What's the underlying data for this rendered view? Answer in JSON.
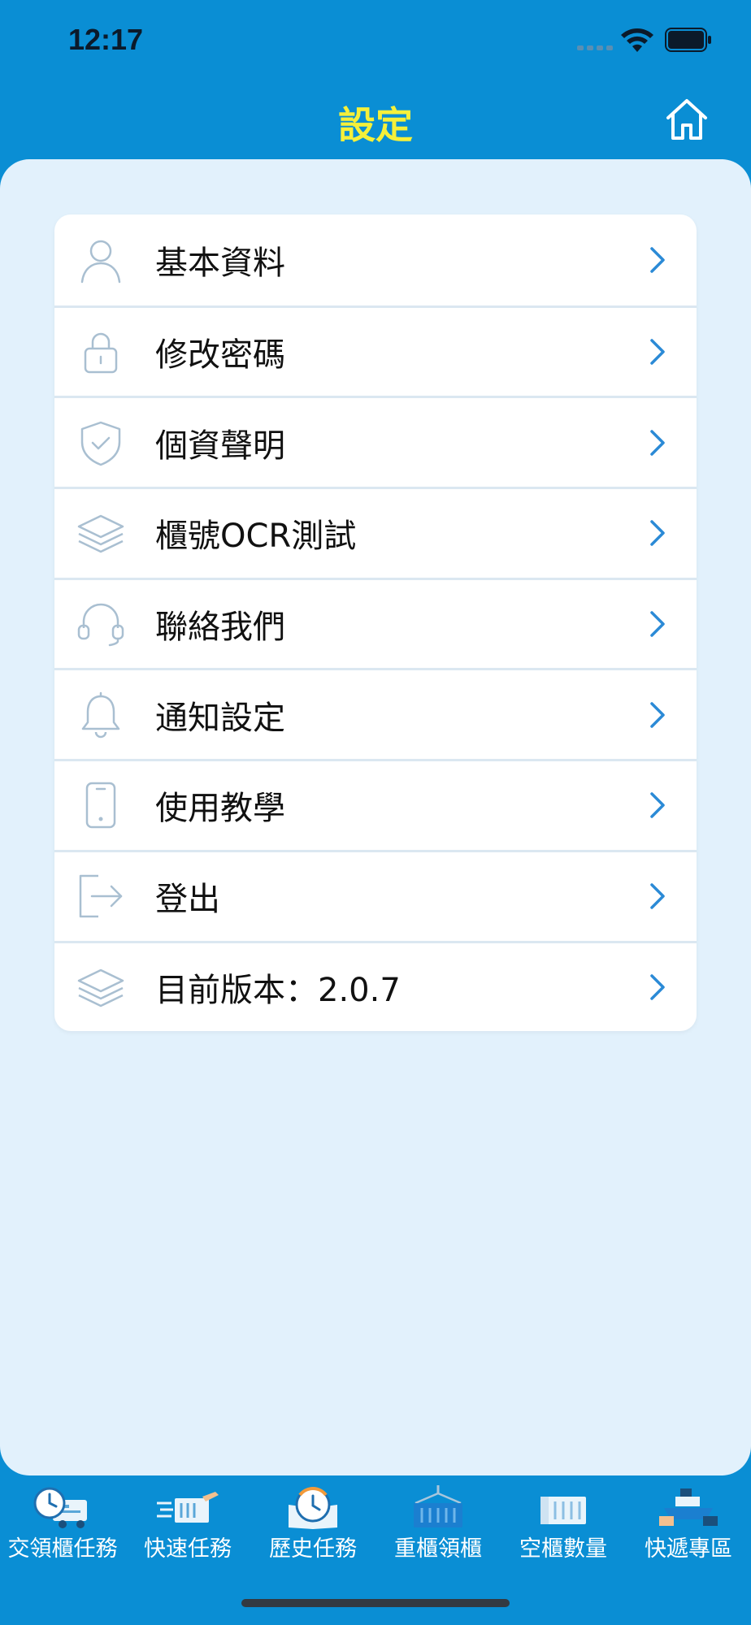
{
  "status_bar": {
    "time": "12:17"
  },
  "header": {
    "title": "設定"
  },
  "settings": {
    "items": [
      {
        "label": "基本資料",
        "icon": "user-icon"
      },
      {
        "label": "修改密碼",
        "icon": "lock-icon"
      },
      {
        "label": "個資聲明",
        "icon": "shield-check-icon"
      },
      {
        "label": "櫃號OCR測試",
        "icon": "layers-icon"
      },
      {
        "label": "聯絡我們",
        "icon": "headset-icon"
      },
      {
        "label": "通知設定",
        "icon": "bell-icon"
      },
      {
        "label": "使用教學",
        "icon": "phone-icon"
      },
      {
        "label": "登出",
        "icon": "logout-icon"
      },
      {
        "label": "目前版本：2.0.7",
        "icon": "layers-icon"
      }
    ]
  },
  "tab_bar": {
    "items": [
      {
        "label": "交領櫃任務",
        "icon": "clock-truck-icon"
      },
      {
        "label": "快速任務",
        "icon": "fast-container-icon"
      },
      {
        "label": "歷史任務",
        "icon": "history-clock-icon"
      },
      {
        "label": "重櫃領櫃",
        "icon": "crane-container-icon"
      },
      {
        "label": "空櫃數量",
        "icon": "empty-container-icon"
      },
      {
        "label": "快遞專區",
        "icon": "ship-icon"
      }
    ]
  },
  "colors": {
    "header_bg": "#0a8ed4",
    "title_color": "#f5f03a",
    "panel_bg": "#e2f1fc",
    "chevron": "#2b8ad6",
    "row_icon": "#a9bfd1"
  }
}
